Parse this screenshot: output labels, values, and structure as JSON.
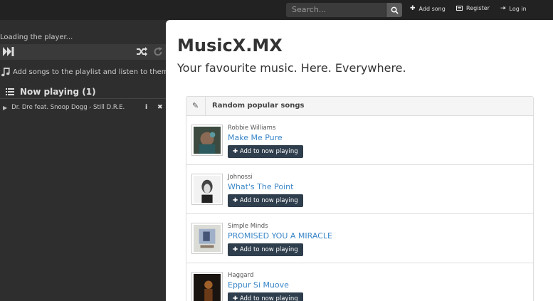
{
  "navbar": {
    "search_placeholder": "Search...",
    "links": [
      {
        "icon": "plus-icon",
        "label": "Add song"
      },
      {
        "icon": "register-icon",
        "label": "Register"
      },
      {
        "icon": "login-icon",
        "label": "Log in"
      }
    ]
  },
  "player": {
    "loading_text": "Loading the player...",
    "add_hint": "Add songs to the playlist and listen to them",
    "now_playing_label": "Now playing (1)",
    "items": [
      {
        "title": "Dr. Dre feat. Snoop Dogg - Still D.R.E."
      }
    ]
  },
  "main": {
    "site_title": "MusicX.MX",
    "tagline": "Your favourite music. Here. Everywhere.",
    "panel_title": "Random popular songs",
    "add_label": "Add to now playing",
    "songs": [
      {
        "artist": "Robbie Williams",
        "title": "Make Me Pure"
      },
      {
        "artist": "Johnossi",
        "title": "What's The Point"
      },
      {
        "artist": "Simple Minds",
        "title": "PROMISED YOU A MIRACLE"
      },
      {
        "artist": "Haggard",
        "title": "Eppur Si Muove"
      }
    ]
  },
  "colors": {
    "sidebar_bg": "#2e2e2e",
    "navbar_bg": "#222222",
    "link_blue": "#3a86c8",
    "button_dark": "#2f3e4d"
  }
}
